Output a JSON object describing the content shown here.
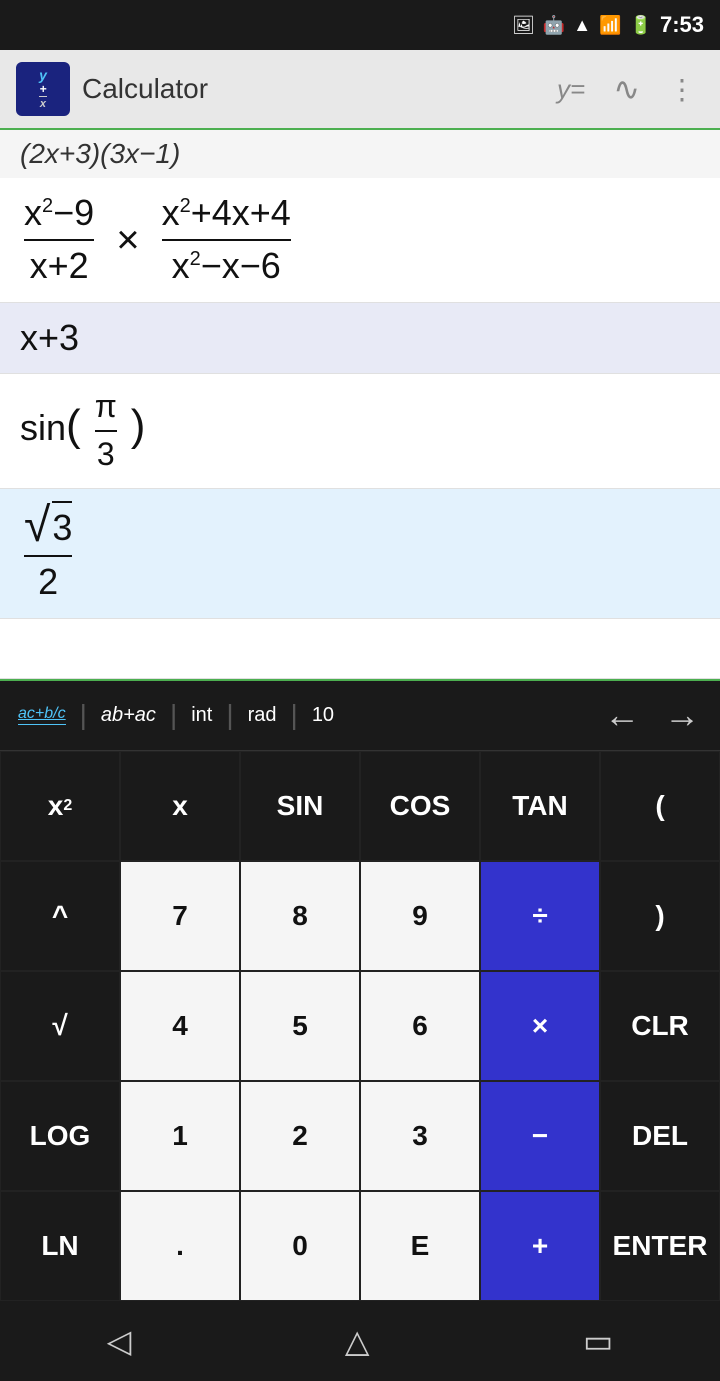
{
  "statusBar": {
    "time": "7:53",
    "icons": [
      "image",
      "android",
      "wifi",
      "signal",
      "battery"
    ]
  },
  "appBar": {
    "title": "Calculator",
    "toolbarButtons": [
      "y=",
      "~",
      "⋮"
    ]
  },
  "display": {
    "topExpr": "(2x+3)(3x−1)",
    "rows": [
      {
        "type": "fraction-times-fraction",
        "expr1Num": "x²−9",
        "expr1Den": "x+2",
        "expr2Num": "x²+4x+4",
        "expr2Den": "x²−x−6"
      },
      {
        "type": "simple",
        "expr": "x+3"
      },
      {
        "type": "sin-fraction",
        "expr": "sin(π/3)"
      },
      {
        "type": "sqrt-fraction",
        "numerator": "√3",
        "denominator": "2"
      }
    ]
  },
  "toolbarStrip": {
    "fractionLabel": "ac+b/c",
    "italicLabel": "ab+ac",
    "intLabel": "int",
    "radLabel": "rad",
    "numLabel": "10",
    "backLabel": "←",
    "forwardLabel": "→"
  },
  "keyboard": {
    "rows": [
      [
        {
          "label": "x²",
          "type": "dark"
        },
        {
          "label": "x",
          "type": "dark"
        },
        {
          "label": "SIN",
          "type": "dark"
        },
        {
          "label": "COS",
          "type": "dark"
        },
        {
          "label": "TAN",
          "type": "dark"
        },
        {
          "label": "(",
          "type": "dark"
        }
      ],
      [
        {
          "label": "^",
          "type": "dark"
        },
        {
          "label": "7",
          "type": "white"
        },
        {
          "label": "8",
          "type": "white"
        },
        {
          "label": "9",
          "type": "white"
        },
        {
          "label": "÷",
          "type": "blue-bright"
        },
        {
          "label": ")",
          "type": "dark"
        }
      ],
      [
        {
          "label": "√",
          "type": "dark"
        },
        {
          "label": "4",
          "type": "white"
        },
        {
          "label": "5",
          "type": "white"
        },
        {
          "label": "6",
          "type": "white"
        },
        {
          "label": "×",
          "type": "blue-bright"
        },
        {
          "label": "CLR",
          "type": "dark"
        }
      ],
      [
        {
          "label": "LOG",
          "type": "dark"
        },
        {
          "label": "1",
          "type": "white"
        },
        {
          "label": "2",
          "type": "white"
        },
        {
          "label": "3",
          "type": "white"
        },
        {
          "label": "−",
          "type": "blue-bright"
        },
        {
          "label": "DEL",
          "type": "dark"
        }
      ],
      [
        {
          "label": "LN",
          "type": "dark"
        },
        {
          "label": ".",
          "type": "white"
        },
        {
          "label": "0",
          "type": "white"
        },
        {
          "label": "E",
          "type": "white"
        },
        {
          "label": "+",
          "type": "blue-bright"
        },
        {
          "label": "ENTER",
          "type": "dark"
        }
      ]
    ]
  },
  "navBar": {
    "back": "◁",
    "home": "△",
    "recents": "▭"
  }
}
